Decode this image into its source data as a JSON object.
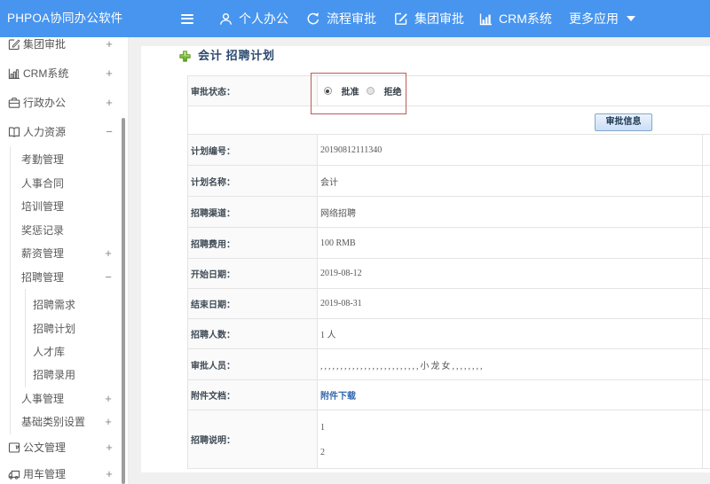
{
  "header": {
    "logo": "PHPOA协同办公软件",
    "nav": [
      {
        "label": "个人办公",
        "icon": "user-icon"
      },
      {
        "label": "流程审批",
        "icon": "cycle-icon"
      },
      {
        "label": "集团审批",
        "icon": "edit-icon"
      },
      {
        "label": "CRM系统",
        "icon": "bar-chart-icon"
      },
      {
        "label": "更多应用",
        "icon": "caret-down-icon"
      }
    ]
  },
  "sidebar": {
    "items": [
      {
        "label": "集团审批",
        "level": 1,
        "icon": "edit-icon",
        "toggle": "+"
      },
      {
        "label": "CRM系统",
        "level": 1,
        "icon": "bar-chart-icon",
        "toggle": "+"
      },
      {
        "label": "行政办公",
        "level": 1,
        "icon": "briefcase-icon",
        "toggle": "+"
      },
      {
        "label": "人力资源",
        "level": 1,
        "icon": "book-icon",
        "toggle": "−",
        "expanded": true
      },
      {
        "label": "考勤管理",
        "level": 2
      },
      {
        "label": "人事合同",
        "level": 2
      },
      {
        "label": "培训管理",
        "level": 2
      },
      {
        "label": "奖惩记录",
        "level": 2
      },
      {
        "label": "薪资管理",
        "level": 2,
        "toggle": "+"
      },
      {
        "label": "招聘管理",
        "level": 2,
        "toggle": "−",
        "expanded": true
      },
      {
        "label": "招聘需求",
        "level": 3
      },
      {
        "label": "招聘计划",
        "level": 3
      },
      {
        "label": "人才库",
        "level": 3
      },
      {
        "label": "招聘录用",
        "level": 3
      },
      {
        "label": "人事管理",
        "level": 2,
        "toggle": "+"
      },
      {
        "label": "基础类别设置",
        "level": 2,
        "toggle": "+"
      },
      {
        "label": "公文管理",
        "level": 1,
        "icon": "document-icon",
        "toggle": "+"
      },
      {
        "label": "用车管理",
        "level": 1,
        "icon": "truck-icon",
        "toggle": "+"
      }
    ]
  },
  "main": {
    "title": "会计 招聘计划",
    "approval": {
      "label": "审批状态：",
      "options": [
        {
          "label": "批准",
          "selected": true
        },
        {
          "label": "拒绝",
          "selected": false
        }
      ]
    },
    "approve_button": "审批信息",
    "fields": [
      {
        "label": "计划编号：",
        "value": "20190812111340"
      },
      {
        "label": "计划名称：",
        "value": "会计"
      },
      {
        "label": "招聘渠道：",
        "value": "网络招聘"
      },
      {
        "label": "招聘费用：",
        "value": "100 RMB"
      },
      {
        "label": "开始日期：",
        "value": "2019-08-12"
      },
      {
        "label": "结束日期：",
        "value": "2019-08-31"
      },
      {
        "label": "招聘人数：",
        "value": "1 人"
      },
      {
        "label": "审批人员：",
        "value": ",,,,,,,,,,,,,,,,,,,,,,,,,小龙女,,,,,,,,"
      },
      {
        "label": "附件文档：",
        "value": "附件下载",
        "type": "link"
      },
      {
        "label": "招聘说明：",
        "value": "1\n2",
        "type": "multiline"
      }
    ]
  },
  "theme": {
    "header_blue": "#4795ef",
    "annotation_red": "#c0504d",
    "link_blue": "#3568af",
    "plus_green": "#6cbf2e",
    "page_bg": "#f0f0f1"
  }
}
